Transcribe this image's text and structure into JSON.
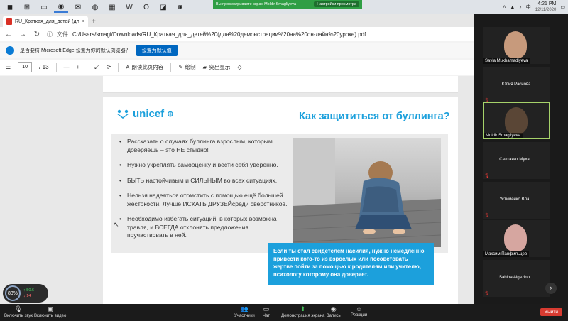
{
  "taskbar": {
    "apps": [
      {
        "name": "zoom-app-icon",
        "glyph": "◼"
      },
      {
        "name": "windows-icon",
        "glyph": "⊞"
      },
      {
        "name": "folder-icon",
        "glyph": "▭"
      },
      {
        "name": "edge-icon",
        "glyph": "◉"
      },
      {
        "name": "mail-icon",
        "glyph": "✉"
      },
      {
        "name": "chrome-icon",
        "glyph": "◍"
      },
      {
        "name": "excel-icon",
        "glyph": "▦"
      },
      {
        "name": "word-icon",
        "glyph": "W"
      },
      {
        "name": "outlook-icon",
        "glyph": "O"
      },
      {
        "name": "store-icon",
        "glyph": "◪"
      },
      {
        "name": "zoom-video-icon",
        "glyph": "◙"
      }
    ],
    "share_banner_text": "Вы просматриваете экран Moldir Smagliyeva",
    "share_banner_button": "Настройки просмотра",
    "ime": "中",
    "time": "4:21 PM",
    "date": "12/11/2020"
  },
  "browser": {
    "tab_title": "RU_Краткая_для_детей (для де...",
    "new_tab": "+",
    "address_prefix": "文件",
    "address_url": "C:/Users/smagi/Downloads/RU_Краткая_для_детей%20(для%20демонстрации%20на%20он-лайн%20уроке).pdf",
    "infobar_text": "是否要将 Microsoft Edge 设置为你的默认浏览器？",
    "infobar_button": "设置为默认值"
  },
  "pdf_toolbar": {
    "page_current": "10",
    "page_total": "/ 13",
    "zoom_out": "—",
    "zoom_in": "+",
    "read_aloud": "朗读此页内容",
    "draw": "绘制",
    "highlight": "突出显示"
  },
  "slide": {
    "logo_text": "unicef",
    "title": "Как защититься от буллинга?",
    "bullets": [
      "Рассказать о случаях буллинга взрослым, которым доверяешь – это НЕ стыдно!",
      "Нужно укреплять самооценку и вести себя уверенно.",
      "БЫТЬ настойчивым и СИЛЬНЫМ во всех ситуациях.",
      "Нельзя надеяться отомстить с помощью ещё большей жестокости. Лучше ИСКАТЬ ДРУЗЕЙсреди сверстников.",
      "Необходимо избегать ситуаций, в которых возможна травля, и ВСЕГДА отклонять предложения поучаствовать в ней."
    ],
    "callout": "Если ты стал свидетелем насилия, нужно немедленно привести кого-то из взрослых или посоветовать жертве пойти за помощью к родителям или учителю, психологу которому она доверяет."
  },
  "participants": [
    {
      "name": "Savia Mukhamadiyeva",
      "video": true
    },
    {
      "name": "Юлия Раснова",
      "video": false
    },
    {
      "name": "Moldir Smagliyeva",
      "video": true,
      "active": true
    },
    {
      "name": "Салтанат Муха...",
      "video": false
    },
    {
      "name": "Устименко Вла...",
      "video": false
    },
    {
      "name": "Максим Панфильцев",
      "video": true
    },
    {
      "name": "Sabina Aigazino...",
      "video": false
    }
  ],
  "zoom_toolbar": {
    "unmute": "Включить звук",
    "start_video": "Включить видео",
    "participants": "Участники",
    "chat": "Чат",
    "share_screen": "Демонстрация экрана",
    "record": "Запись",
    "reactions": "Реакции",
    "leave": "Выйти"
  },
  "network": {
    "percent": "83%",
    "upload": "50.6",
    "download": "14"
  },
  "colors": {
    "unicef_blue": "#1ca0dc",
    "share_green": "#2f9e44",
    "leave_red": "#d83b31"
  }
}
